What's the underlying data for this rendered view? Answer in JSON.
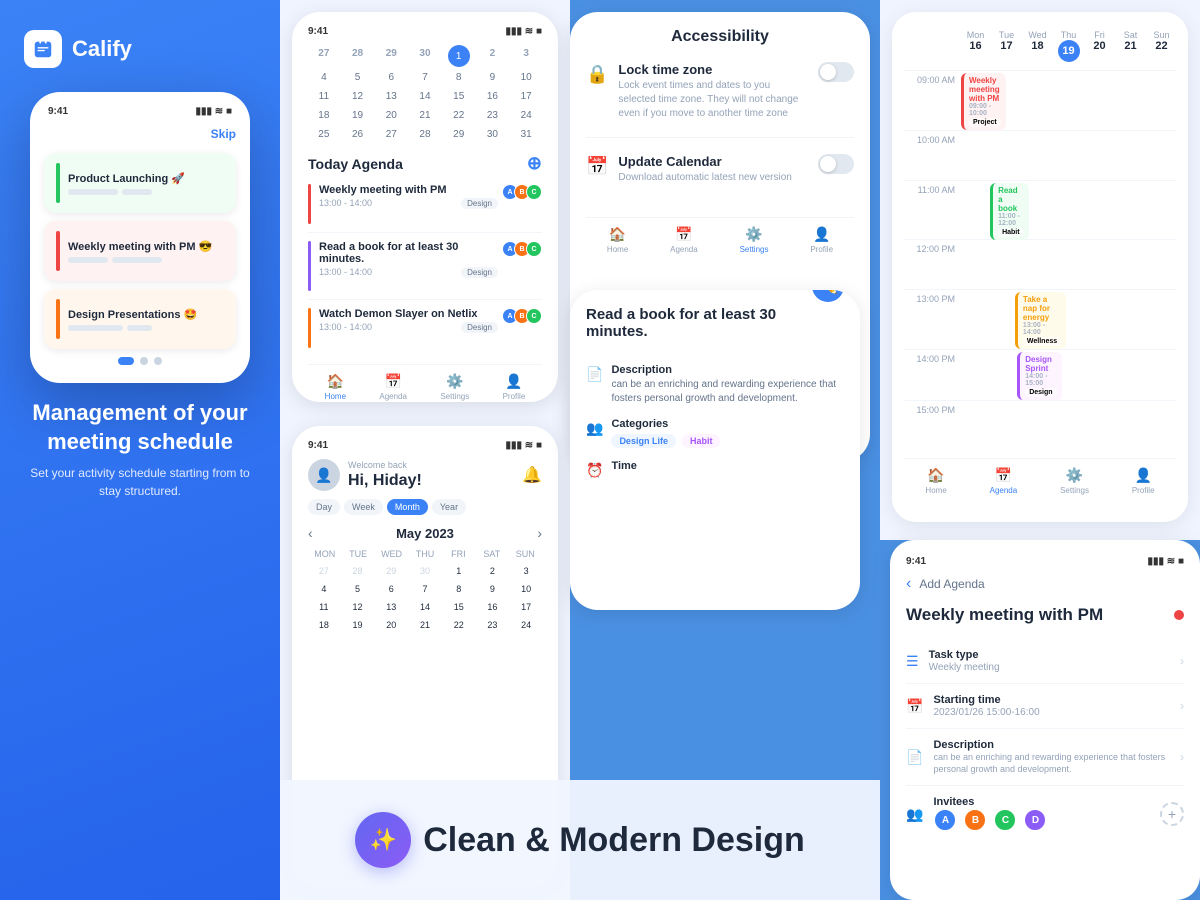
{
  "app": {
    "name": "Calify",
    "logo_color": "#3b82f6"
  },
  "hero": {
    "tagline": "Management of your meeting schedule",
    "subtitle": "Set your activity schedule starting from to stay structured.",
    "skip_label": "Skip",
    "tasks": [
      {
        "title": "Product Launching 🚀",
        "bar_color": "#22c55e",
        "bg": "#f0fdf4"
      },
      {
        "title": "Weekly meeting with PM 😎",
        "bar_color": "#ef4444",
        "bg": "#fef2f2"
      },
      {
        "title": "Design Presentations 🤩",
        "bar_color": "#f97316",
        "bg": "#fff7ed"
      }
    ],
    "dots": [
      "active",
      "inactive",
      "inactive"
    ],
    "status_time": "9:41"
  },
  "calendar_panel": {
    "status_time": "9:41",
    "welcome": "Welcome back",
    "greeting": "Hi, Hiday!",
    "month": "May 2023",
    "views": [
      "Day",
      "Week",
      "Month",
      "Year"
    ],
    "active_view": "Month",
    "days_header": [
      "MON",
      "TUE",
      "WED",
      "THU",
      "FRI",
      "SAT",
      "SUN"
    ],
    "weeks": [
      [
        27,
        28,
        29,
        30,
        1,
        2,
        3
      ],
      [
        4,
        5,
        6,
        7,
        8,
        9,
        10
      ],
      [
        11,
        12,
        13,
        14,
        15,
        16,
        17
      ],
      [
        18,
        19,
        20,
        21,
        22,
        23,
        24
      ],
      [
        25,
        26,
        27,
        28,
        29,
        30,
        31
      ]
    ],
    "today": 1,
    "agenda_title": "Today Agenda",
    "agenda_items": [
      {
        "title": "Weekly meeting with PM",
        "time": "13:00 - 14:00",
        "tag": "Design",
        "bar_color": "#ef4444",
        "avatars": [
          "#3b82f6",
          "#f97316",
          "#22c55e"
        ]
      },
      {
        "title": "Read a book for at least 30 minutes.",
        "time": "13:00 - 14:00",
        "tag": "Design",
        "bar_color": "#8b5cf6",
        "avatars": [
          "#3b82f6",
          "#f97316",
          "#22c55e"
        ]
      },
      {
        "title": "Watch Demon Slayer on Netlix",
        "time": "13:00 - 14:00",
        "tag": "Design",
        "bar_color": "#f97316",
        "avatars": [
          "#3b82f6",
          "#f97316",
          "#22c55e"
        ]
      }
    ],
    "nav": [
      "Home",
      "Agenda",
      "Settings",
      "Profile"
    ]
  },
  "settings_panel": {
    "title": "Accessibility",
    "items": [
      {
        "icon": "🔒",
        "title": "Lock time zone",
        "desc": "Lock event times and dates to you selected time zone. They will not change even if you move to another time zone",
        "toggled": false
      },
      {
        "icon": "📅",
        "title": "Update Calendar",
        "desc": "Download automatic latest new version",
        "toggled": false
      }
    ],
    "nav": [
      "Home",
      "Agenda",
      "Settings",
      "Profile"
    ]
  },
  "detail_panel": {
    "title": "Read a book for at least 30 minutes.",
    "sections": [
      {
        "icon": "📄",
        "title": "Description",
        "text": "can be an enriching and rewarding experience that fosters personal growth and development."
      },
      {
        "icon": "👥",
        "title": "Categories",
        "tags": [
          {
            "label": "Design Life",
            "bg": "#eff6ff",
            "color": "#3b82f6"
          },
          {
            "label": "Habit",
            "bg": "#fdf4ff",
            "color": "#a855f7"
          }
        ]
      },
      {
        "icon": "⏰",
        "title": "Time",
        "text": ""
      }
    ]
  },
  "weekly_panel": {
    "days": [
      {
        "name": "Mon",
        "num": "16"
      },
      {
        "name": "Tue",
        "num": "17"
      },
      {
        "name": "Wed",
        "num": "18"
      },
      {
        "name": "Thu",
        "num": "19",
        "today": true
      },
      {
        "name": "Fri",
        "num": "20"
      },
      {
        "name": "Sat",
        "num": "21"
      },
      {
        "name": "Sun",
        "num": "22"
      }
    ],
    "times": [
      "09:00 AM",
      "10:00 AM",
      "11:00 AM",
      "12:00 PM",
      "13:00 PM",
      "14:00 PM",
      "15:00 PM"
    ],
    "events": [
      {
        "day": 1,
        "time_idx": 0,
        "title": "Weekly meeting with PM",
        "time": "09:00 - 10:00",
        "tag": "Project",
        "bg": "#fef2f2",
        "color": "#ef4444",
        "border": "#ef4444"
      },
      {
        "day": 2,
        "time_idx": 2,
        "title": "Read a book",
        "time": "11:00 - 12:00",
        "tag": "Habit",
        "bg": "#f0fdf4",
        "color": "#22c55e",
        "border": "#22c55e"
      },
      {
        "day": 3,
        "time_idx": 4,
        "title": "Take a nap for energy",
        "time": "13:00 - 14:00",
        "tag": "Wellness",
        "bg": "#fffbeb",
        "color": "#f59e0b",
        "border": "#f59e0b"
      },
      {
        "day": 3,
        "time_idx": 5,
        "title": "Design Sprint",
        "time": "14:00 - 15:00",
        "tag": "Design",
        "bg": "#fdf4ff",
        "color": "#a855f7",
        "border": "#a855f7"
      }
    ],
    "nav": [
      "Home",
      "Agenda",
      "Settings",
      "Profile"
    ],
    "active_nav": "Agenda"
  },
  "add_agenda_panel": {
    "status_time": "9:41",
    "back_label": "Add Agenda",
    "meeting_title": "Weekly meeting with PM",
    "fields": [
      {
        "icon": "☰",
        "label": "Task type",
        "value": "Weekly meeting"
      },
      {
        "icon": "📅",
        "label": "Starting time",
        "value": "2023/01/26  15:00-16:00"
      },
      {
        "icon": "📄",
        "label": "Description",
        "value": "can be an enriching and rewarding experience that fosters personal growth and development."
      },
      {
        "icon": "👥",
        "label": "Invitees",
        "value": ""
      }
    ],
    "invitees": [
      {
        "color": "#3b82f6",
        "initials": "A"
      },
      {
        "color": "#f97316",
        "initials": "B"
      },
      {
        "color": "#22c55e",
        "initials": "C"
      },
      {
        "color": "#8b5cf6",
        "initials": "D"
      }
    ]
  },
  "banner": {
    "icon": "✨",
    "text": "Clean & Modern Design"
  }
}
